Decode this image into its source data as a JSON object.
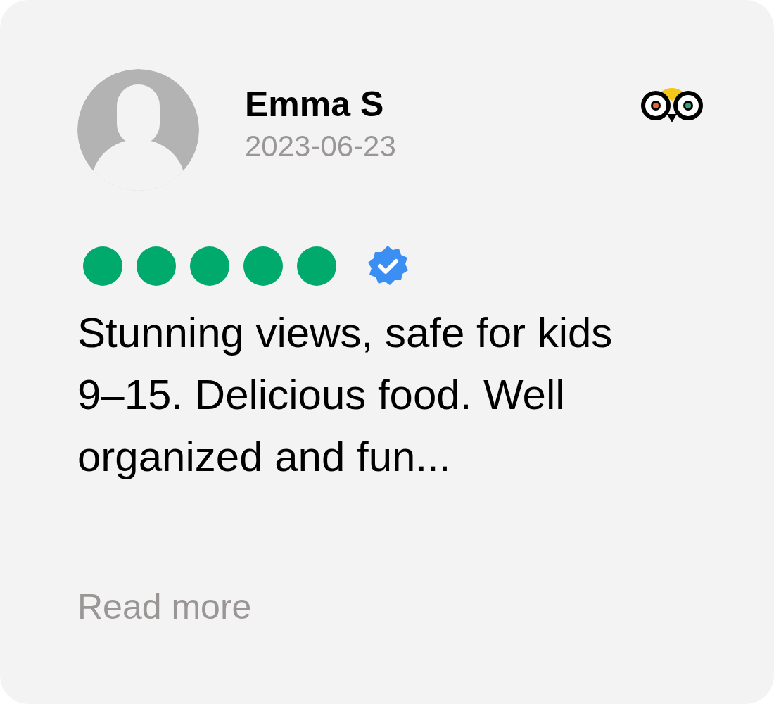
{
  "review": {
    "author": "Emma S",
    "date": "2023-06-23",
    "stars": 5,
    "verified": true,
    "text": "Stunning views, safe for kids 9–15. Delicious food. Well organized and fun...",
    "link": "Read more"
  }
}
